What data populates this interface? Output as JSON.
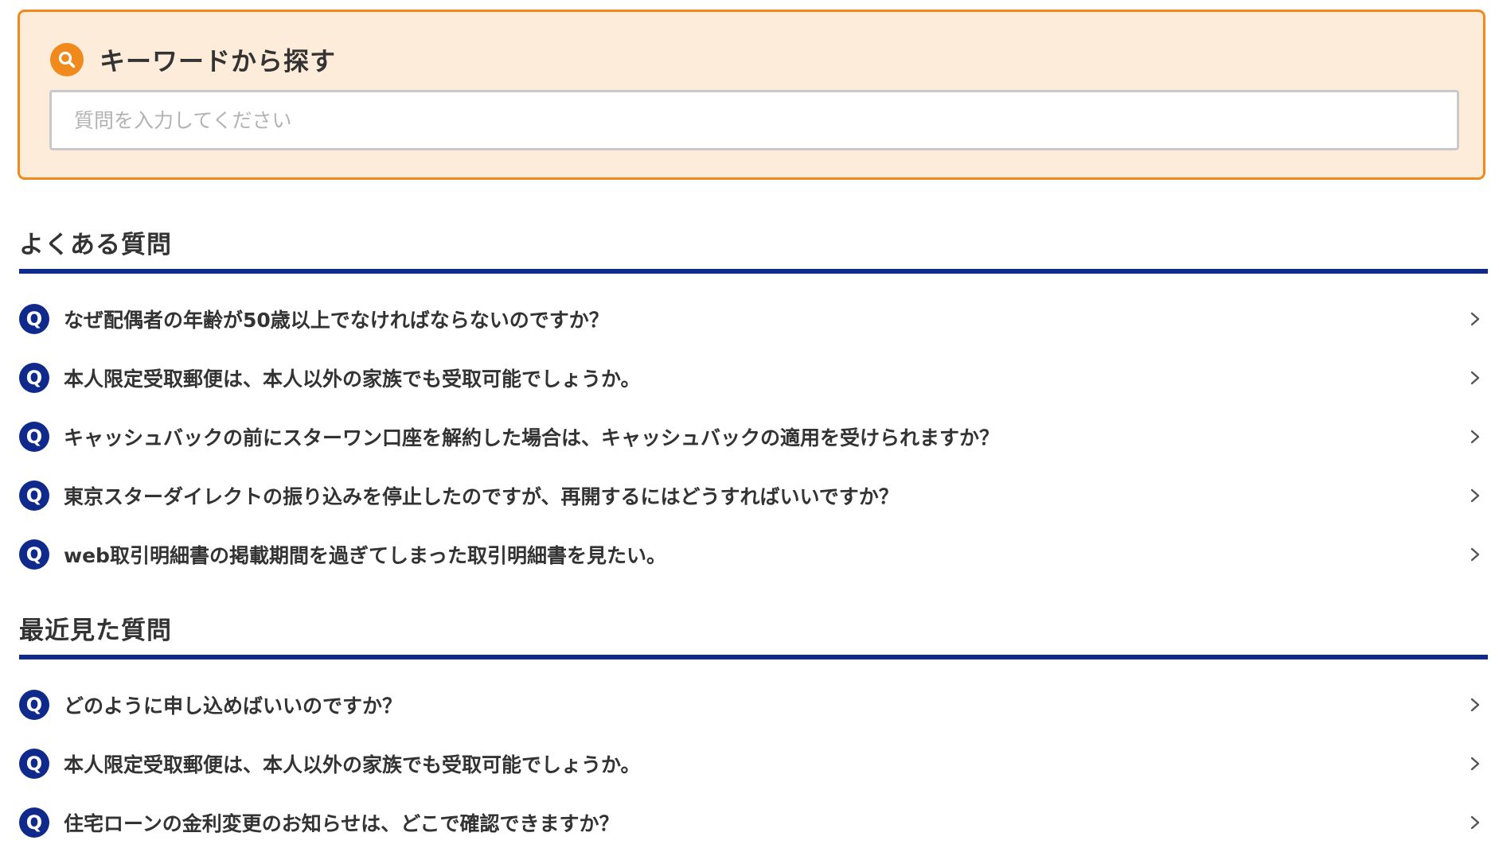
{
  "search": {
    "title": "キーワードから探す",
    "placeholder": "質問を入力してください",
    "value": "",
    "icon": "search-icon",
    "accent": "#f08a1c"
  },
  "popular": {
    "title": "よくある質問",
    "items": [
      {
        "badge": "Q",
        "text": "なぜ配偶者の年齢が50歳以上でなければならないのですか？"
      },
      {
        "badge": "Q",
        "text": "本人限定受取郵便は、本人以外の家族でも受取可能でしょうか。"
      },
      {
        "badge": "Q",
        "text": "キャッシュバックの前にスターワン口座を解約した場合は、キャッシュバックの適用を受けられますか？"
      },
      {
        "badge": "Q",
        "text": "東京スターダイレクトの振り込みを停止したのですが、再開するにはどうすればいいですか？"
      },
      {
        "badge": "Q",
        "text": "web取引明細書の掲載期間を過ぎてしまった取引明細書を見たい。"
      }
    ]
  },
  "recent": {
    "title": "最近見た質問",
    "items": [
      {
        "badge": "Q",
        "text": "どのように申し込めばいいのですか？"
      },
      {
        "badge": "Q",
        "text": "本人限定受取郵便は、本人以外の家族でも受取可能でしょうか。"
      },
      {
        "badge": "Q",
        "text": "住宅ローンの金利変更のお知らせは、どこで確認できますか？"
      }
    ]
  },
  "colors": {
    "brand_navy": "#102a8c",
    "search_bg": "#fdecda",
    "text": "#333333"
  }
}
